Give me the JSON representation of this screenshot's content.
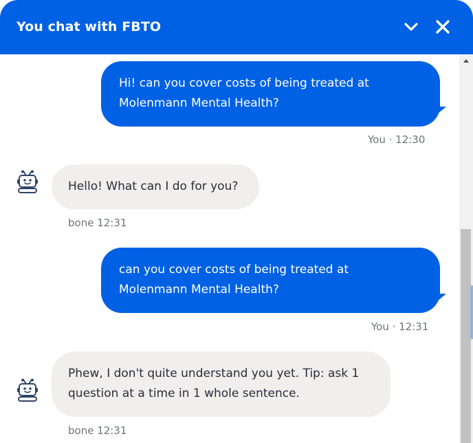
{
  "header": {
    "title": "You chat with FBTO",
    "background_color": "#0061e4"
  },
  "messages": [
    {
      "sender": "user",
      "lines": [
        "Hi! can you cover costs of being treated at",
        "Molenmann Mental Health?"
      ],
      "meta": "You · 12:30"
    },
    {
      "sender": "bot",
      "lines": [
        "Hello! What can I do for you?"
      ],
      "meta": "bone 12:31"
    },
    {
      "sender": "user",
      "lines": [
        "can you cover costs of being treated at",
        "Molenmann Mental Health?"
      ],
      "meta": "You · 12:31"
    },
    {
      "sender": "bot",
      "lines": [
        "Phew, I don't quite understand you yet. Tip: ask 1",
        "question at a time in 1 whole sentence."
      ],
      "meta": "bone 12:31"
    }
  ],
  "icons": {
    "minimize": "chevron-down-icon",
    "close": "close-icon",
    "bot_avatar": "robot-icon"
  },
  "colors": {
    "user_bubble": "#0061e4",
    "bot_bubble": "#f0efed",
    "meta_text": "#6e7278"
  }
}
